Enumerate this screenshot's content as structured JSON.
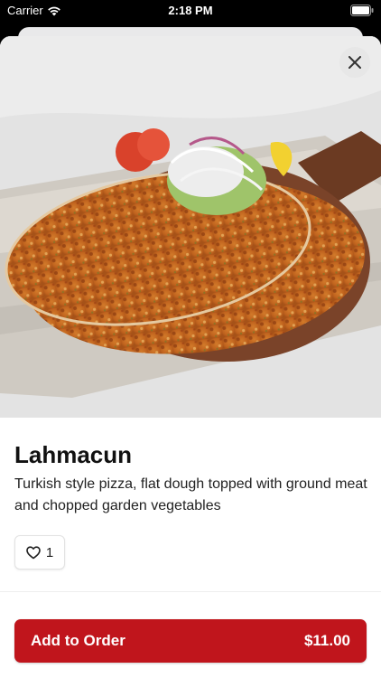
{
  "status_bar": {
    "carrier": "Carrier",
    "time": "2:18 PM",
    "icons": [
      "wifi-icon",
      "battery-icon"
    ]
  },
  "product": {
    "image_alt": "Lahmacun",
    "name": "Lahmacun",
    "description": "Turkish style pizza, flat dough topped with ground meat and chopped garden vegetables",
    "like_count": "1"
  },
  "actions": {
    "close_icon": "close-icon",
    "like_icon": "heart-outline-icon",
    "add_to_order_label": "Add to Order",
    "price": "$11.00"
  },
  "colors": {
    "accent": "#c0151c",
    "background": "#ffffff",
    "text": "#111111"
  }
}
